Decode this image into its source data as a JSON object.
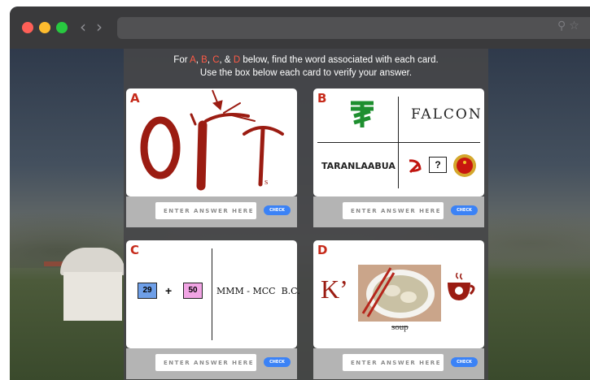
{
  "browser": {
    "nav": {
      "back": "‹",
      "forward": "›"
    },
    "icons": [
      "search-icon",
      "star-icon"
    ]
  },
  "instructions": {
    "line1_pre": "For ",
    "letters": [
      "A",
      "B",
      "C",
      "D"
    ],
    "sep1": ", ",
    "sep2": ", ",
    "sep3": ", & ",
    "line1_post": " below, find the word associated with each card.",
    "line2": "Use the box below each card to verify your answer."
  },
  "colors": {
    "letter_accent": "#c62a1a",
    "highlight": "#ff5a46",
    "check_button": "#3b82f6"
  },
  "cards": {
    "a": {
      "letter": "A"
    },
    "b": {
      "letter": "B",
      "word_falcon": "FALCON",
      "word_taranlaabua": "TARANLAABUA",
      "question_box": "?",
      "symbols": [
        "tugrik-icon",
        "hammer-sickle-icon",
        "national-emblem-icon"
      ]
    },
    "c": {
      "letter": "C",
      "num1": "29",
      "plus": "+",
      "num2": "50",
      "text": "MMM - MCC  B.C."
    },
    "d": {
      "letter": "D",
      "k": "K’",
      "soup": "soup",
      "symbols": [
        "dumpling-soup-image",
        "tea-cup-icon"
      ]
    }
  },
  "answer": {
    "placeholder": "ENTER ANSWER HERE",
    "check_label": "CHECK"
  }
}
